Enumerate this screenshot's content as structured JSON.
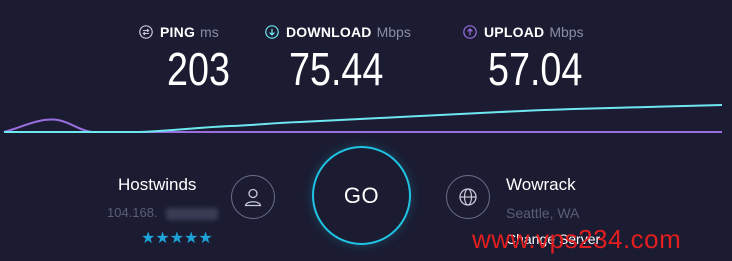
{
  "metrics": {
    "ping": {
      "label": "PING",
      "unit": "ms",
      "value": "203",
      "icon": "ping-icon"
    },
    "download": {
      "label": "DOWNLOAD",
      "unit": "Mbps",
      "value": "75.44",
      "icon": "download-arrow-icon"
    },
    "upload": {
      "label": "UPLOAD",
      "unit": "Mbps",
      "value": "57.04",
      "icon": "upload-arrow-icon"
    }
  },
  "colors": {
    "background": "#1b1c32",
    "download": "#6ee8f0",
    "upload": "#9b6ee0",
    "accent": "#20c4e3",
    "rating": "#1ea3d8",
    "watermark": "#e21e1e"
  },
  "isp": {
    "name": "Hostwinds",
    "ip": "104.168.",
    "rating": "★★★★★",
    "icon": "user-icon"
  },
  "go_button": {
    "label": "GO"
  },
  "server": {
    "name": "Wowrack",
    "location": "Seattle, WA",
    "change_label": "Change Server",
    "icon": "globe-icon"
  },
  "watermark": "www.vps234.com"
}
